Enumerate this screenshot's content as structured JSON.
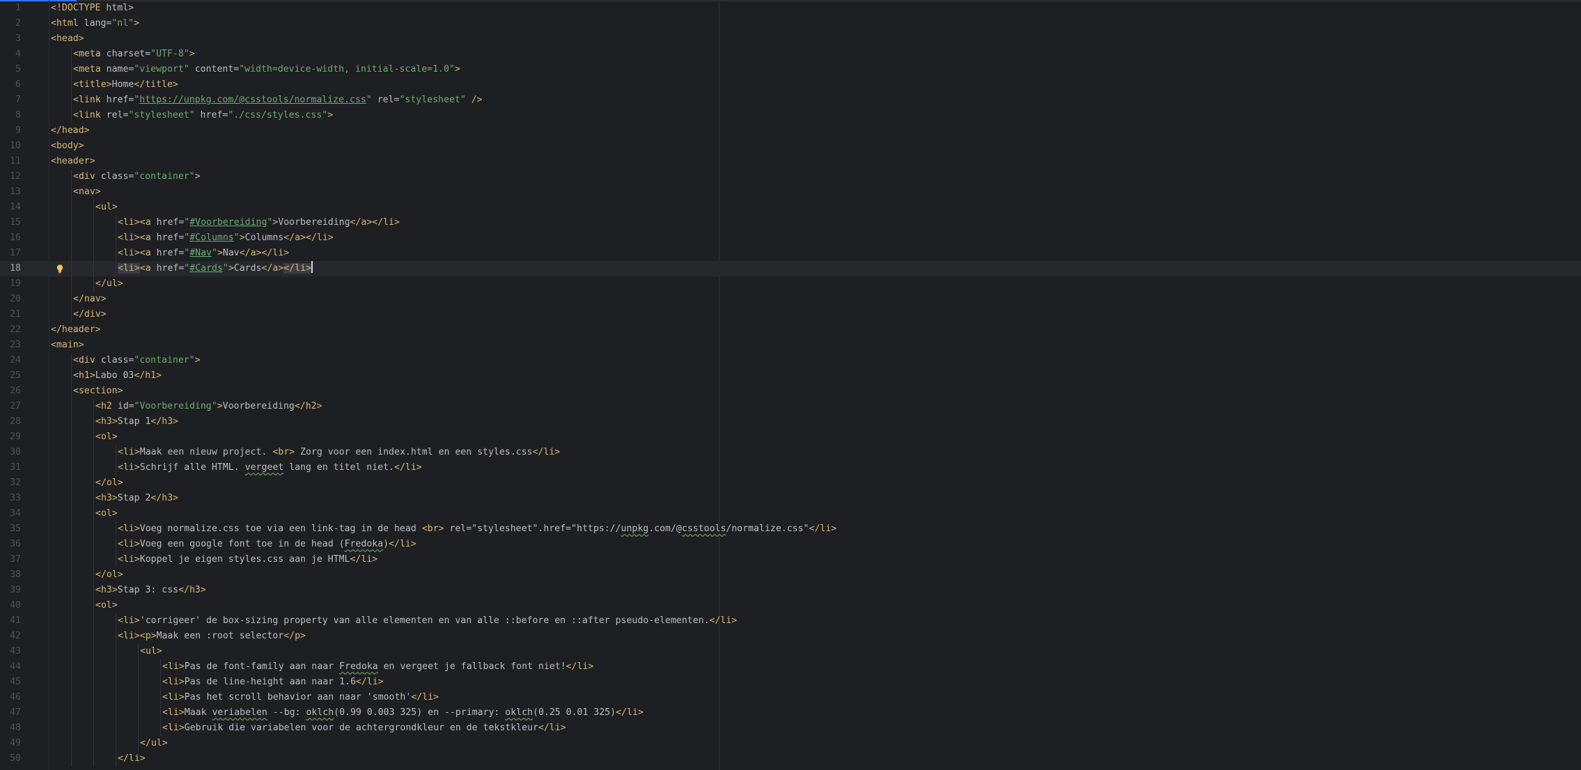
{
  "editor": {
    "current_line": 18,
    "lines": [
      {
        "n": "1",
        "indent": 0,
        "tokens": [
          [
            "t",
            "<!DOCTYPE "
          ],
          [
            "a",
            "html"
          ],
          [
            "t",
            ">"
          ]
        ]
      },
      {
        "n": "2",
        "indent": 0,
        "tokens": [
          [
            "t",
            "<html "
          ],
          [
            "a",
            "lang="
          ],
          [
            "s",
            "\"nl\""
          ],
          [
            "t",
            ">"
          ]
        ]
      },
      {
        "n": "3",
        "indent": 0,
        "tokens": [
          [
            "t",
            "<head>"
          ]
        ]
      },
      {
        "n": "4",
        "indent": 1,
        "tokens": [
          [
            "t",
            "<meta "
          ],
          [
            "a",
            "charset="
          ],
          [
            "s",
            "\"UTF-8\""
          ],
          [
            "t",
            ">"
          ]
        ]
      },
      {
        "n": "5",
        "indent": 1,
        "tokens": [
          [
            "t",
            "<meta "
          ],
          [
            "a",
            "name="
          ],
          [
            "s",
            "\"viewport\" "
          ],
          [
            "a",
            "content="
          ],
          [
            "s",
            "\"width=device-width, initial-scale=1.0\""
          ],
          [
            "t",
            ">"
          ]
        ]
      },
      {
        "n": "6",
        "indent": 1,
        "tokens": [
          [
            "t",
            "<title>"
          ],
          [
            "txt",
            "Home"
          ],
          [
            "t",
            "</title>"
          ]
        ]
      },
      {
        "n": "7",
        "indent": 1,
        "tokens": [
          [
            "t",
            "<link "
          ],
          [
            "a",
            "href="
          ],
          [
            "s",
            "\""
          ],
          [
            "link",
            "https://unpkg.com/@csstools/normalize.css"
          ],
          [
            "s",
            "\" "
          ],
          [
            "a",
            "rel="
          ],
          [
            "s",
            "\"stylesheet\" "
          ],
          [
            "t",
            "/>"
          ]
        ]
      },
      {
        "n": "8",
        "indent": 1,
        "tokens": [
          [
            "t",
            "<link "
          ],
          [
            "a",
            "rel="
          ],
          [
            "s",
            "\"stylesheet\" "
          ],
          [
            "a",
            "href="
          ],
          [
            "s",
            "\"./css/styles.css\""
          ],
          [
            "t",
            ">"
          ]
        ]
      },
      {
        "n": "9",
        "indent": 0,
        "tokens": [
          [
            "t",
            "</head>"
          ]
        ]
      },
      {
        "n": "10",
        "indent": 0,
        "tokens": [
          [
            "t",
            "<body>"
          ]
        ]
      },
      {
        "n": "11",
        "indent": 0,
        "tokens": [
          [
            "t",
            "<header>"
          ]
        ]
      },
      {
        "n": "12",
        "indent": 1,
        "tokens": [
          [
            "t",
            "<div "
          ],
          [
            "a",
            "class="
          ],
          [
            "s",
            "\"container\""
          ],
          [
            "t",
            ">"
          ]
        ]
      },
      {
        "n": "13",
        "indent": 1,
        "tokens": [
          [
            "t",
            "<nav>"
          ]
        ]
      },
      {
        "n": "14",
        "indent": 2,
        "tokens": [
          [
            "t",
            "<ul>"
          ]
        ]
      },
      {
        "n": "15",
        "indent": 3,
        "tokens": [
          [
            "t",
            "<li><a "
          ],
          [
            "a",
            "href="
          ],
          [
            "s",
            "\""
          ],
          [
            "link",
            "#Voorbereiding"
          ],
          [
            "s",
            "\""
          ],
          [
            "t",
            ">"
          ],
          [
            "txt",
            "Voorbereiding"
          ],
          [
            "t",
            "</a></li>"
          ]
        ]
      },
      {
        "n": "16",
        "indent": 3,
        "tokens": [
          [
            "t",
            "<li><a "
          ],
          [
            "a",
            "href="
          ],
          [
            "s",
            "\""
          ],
          [
            "link",
            "#Columns"
          ],
          [
            "s",
            "\""
          ],
          [
            "t",
            ">"
          ],
          [
            "txt",
            "Columns"
          ],
          [
            "t",
            "</a></li>"
          ]
        ]
      },
      {
        "n": "17",
        "indent": 3,
        "tokens": [
          [
            "t",
            "<li><a "
          ],
          [
            "a",
            "href="
          ],
          [
            "s",
            "\""
          ],
          [
            "link",
            "#Nav"
          ],
          [
            "s",
            "\""
          ],
          [
            "t",
            ">"
          ],
          [
            "txt",
            "Nav"
          ],
          [
            "t",
            "</a></li>"
          ]
        ]
      },
      {
        "n": "18",
        "indent": 3,
        "tokens": [
          [
            "hl",
            "<li>"
          ],
          [
            "t",
            "<a "
          ],
          [
            "a",
            "href="
          ],
          [
            "s",
            "\""
          ],
          [
            "link",
            "#Cards"
          ],
          [
            "s",
            "\""
          ],
          [
            "t",
            ">"
          ],
          [
            "txt",
            "Cards"
          ],
          [
            "t",
            "</a>"
          ],
          [
            "hl",
            "</li>"
          ]
        ]
      },
      {
        "n": "19",
        "indent": 2,
        "tokens": [
          [
            "t",
            "</ul>"
          ]
        ]
      },
      {
        "n": "20",
        "indent": 1,
        "tokens": [
          [
            "t",
            "</nav>"
          ]
        ]
      },
      {
        "n": "21",
        "indent": 1,
        "tokens": [
          [
            "t",
            "</div>"
          ]
        ]
      },
      {
        "n": "22",
        "indent": 0,
        "tokens": [
          [
            "t",
            "</header>"
          ]
        ]
      },
      {
        "n": "23",
        "indent": 0,
        "tokens": [
          [
            "t",
            "<main>"
          ]
        ]
      },
      {
        "n": "24",
        "indent": 1,
        "tokens": [
          [
            "t",
            "<div "
          ],
          [
            "a",
            "class="
          ],
          [
            "s",
            "\"container\""
          ],
          [
            "t",
            ">"
          ]
        ]
      },
      {
        "n": "25",
        "indent": 1,
        "tokens": [
          [
            "t",
            "<h1>"
          ],
          [
            "txt",
            "Labo 03"
          ],
          [
            "t",
            "</h1>"
          ]
        ]
      },
      {
        "n": "26",
        "indent": 1,
        "tokens": [
          [
            "t",
            "<section>"
          ]
        ]
      },
      {
        "n": "27",
        "indent": 2,
        "tokens": [
          [
            "t",
            "<h2 "
          ],
          [
            "a",
            "id="
          ],
          [
            "s",
            "\"Voorbereiding\""
          ],
          [
            "t",
            ">"
          ],
          [
            "txt",
            "Voorbereiding"
          ],
          [
            "t",
            "</h2>"
          ]
        ]
      },
      {
        "n": "28",
        "indent": 2,
        "tokens": [
          [
            "t",
            "<h3>"
          ],
          [
            "txt",
            "Stap 1"
          ],
          [
            "t",
            "</h3>"
          ]
        ]
      },
      {
        "n": "29",
        "indent": 2,
        "tokens": [
          [
            "t",
            "<ol>"
          ]
        ]
      },
      {
        "n": "30",
        "indent": 3,
        "tokens": [
          [
            "t",
            "<li>"
          ],
          [
            "txt",
            "Maak een nieuw project. "
          ],
          [
            "t",
            "<br>"
          ],
          [
            "txt",
            " Zorg voor een index.html en een styles.css"
          ],
          [
            "t",
            "</li>"
          ]
        ]
      },
      {
        "n": "31",
        "indent": 3,
        "tokens": [
          [
            "t",
            "<li>"
          ],
          [
            "txt",
            "Schrijf alle HTML. "
          ],
          [
            "wavy",
            "vergeet"
          ],
          [
            "txt",
            " lang en titel niet."
          ],
          [
            "t",
            "</li>"
          ]
        ]
      },
      {
        "n": "32",
        "indent": 2,
        "tokens": [
          [
            "t",
            "</ol>"
          ]
        ]
      },
      {
        "n": "33",
        "indent": 2,
        "tokens": [
          [
            "t",
            "<h3>"
          ],
          [
            "txt",
            "Stap 2"
          ],
          [
            "t",
            "</h3>"
          ]
        ]
      },
      {
        "n": "34",
        "indent": 2,
        "tokens": [
          [
            "t",
            "<ol>"
          ]
        ]
      },
      {
        "n": "35",
        "indent": 3,
        "tokens": [
          [
            "t",
            "<li>"
          ],
          [
            "txt",
            "Voeg normalize.css toe via een link-tag in de head "
          ],
          [
            "t",
            "<br>"
          ],
          [
            "txt",
            " rel=\"stylesheet\".href=\"https://"
          ],
          [
            "wavy",
            "unpkg"
          ],
          [
            "txt",
            ".com/@"
          ],
          [
            "wavy",
            "csstools"
          ],
          [
            "txt",
            "/normalize.css\""
          ],
          [
            "t",
            "</li>"
          ]
        ]
      },
      {
        "n": "36",
        "indent": 3,
        "tokens": [
          [
            "t",
            "<li>"
          ],
          [
            "txt",
            "Voeg een google font toe in de head ("
          ],
          [
            "wavy",
            "Fredoka"
          ],
          [
            "txt",
            ")"
          ],
          [
            "t",
            "</li>"
          ]
        ]
      },
      {
        "n": "37",
        "indent": 3,
        "tokens": [
          [
            "t",
            "<li>"
          ],
          [
            "txt",
            "Koppel je eigen styles.css aan je HTML"
          ],
          [
            "t",
            "</li>"
          ]
        ]
      },
      {
        "n": "38",
        "indent": 2,
        "tokens": [
          [
            "t",
            "</ol>"
          ]
        ]
      },
      {
        "n": "39",
        "indent": 2,
        "tokens": [
          [
            "t",
            "<h3>"
          ],
          [
            "txt",
            "Stap 3: css"
          ],
          [
            "t",
            "</h3>"
          ]
        ]
      },
      {
        "n": "40",
        "indent": 2,
        "tokens": [
          [
            "t",
            "<ol>"
          ]
        ]
      },
      {
        "n": "41",
        "indent": 3,
        "tokens": [
          [
            "t",
            "<li>"
          ],
          [
            "txt",
            "'corrigeer' de box-sizing property van alle elementen en van alle ::before en ::after pseudo-elementen."
          ],
          [
            "t",
            "</li>"
          ]
        ]
      },
      {
        "n": "42",
        "indent": 3,
        "tokens": [
          [
            "t",
            "<li><p>"
          ],
          [
            "txt",
            "Maak een :root selector"
          ],
          [
            "t",
            "</p>"
          ]
        ]
      },
      {
        "n": "43",
        "indent": 4,
        "tokens": [
          [
            "t",
            "<ul>"
          ]
        ]
      },
      {
        "n": "44",
        "indent": 5,
        "tokens": [
          [
            "t",
            "<li>"
          ],
          [
            "txt",
            "Pas de font-family aan naar "
          ],
          [
            "wavy",
            "Fredoka"
          ],
          [
            "txt",
            " en vergeet je fallback font niet!"
          ],
          [
            "t",
            "</li>"
          ]
        ]
      },
      {
        "n": "45",
        "indent": 5,
        "tokens": [
          [
            "t",
            "<li>"
          ],
          [
            "txt",
            "Pas de line-height aan naar 1.6"
          ],
          [
            "t",
            "</li>"
          ]
        ]
      },
      {
        "n": "46",
        "indent": 5,
        "tokens": [
          [
            "t",
            "<li>"
          ],
          [
            "txt",
            "Pas het scroll behavior aan naar 'smooth'"
          ],
          [
            "t",
            "</li>"
          ]
        ]
      },
      {
        "n": "47",
        "indent": 5,
        "tokens": [
          [
            "t",
            "<li>"
          ],
          [
            "txt",
            "Maak "
          ],
          [
            "wavy",
            "veriabelen"
          ],
          [
            "txt",
            " --bg: "
          ],
          [
            "wavy",
            "oklch"
          ],
          [
            "txt",
            "(0.99 0.003 325) en --primary: "
          ],
          [
            "wavy",
            "oklch"
          ],
          [
            "txt",
            "(0.25 0.01 325)"
          ],
          [
            "t",
            "</li>"
          ]
        ]
      },
      {
        "n": "48",
        "indent": 5,
        "tokens": [
          [
            "t",
            "<li>"
          ],
          [
            "txt",
            "Gebruik die variabelen voor de achtergrondkleur en de tekstkleur"
          ],
          [
            "t",
            "</li>"
          ]
        ]
      },
      {
        "n": "49",
        "indent": 4,
        "tokens": [
          [
            "t",
            "</ul>"
          ]
        ]
      },
      {
        "n": "50",
        "indent": 3,
        "tokens": [
          [
            "t",
            "</li>"
          ]
        ]
      }
    ]
  },
  "icons": {
    "intention_bulb": "lightbulb-icon"
  },
  "colors": {
    "background": "#1e1f22",
    "tag": "#d5b778",
    "string": "#6aab73",
    "text": "#bcbec4",
    "accent": "#3574f0"
  }
}
